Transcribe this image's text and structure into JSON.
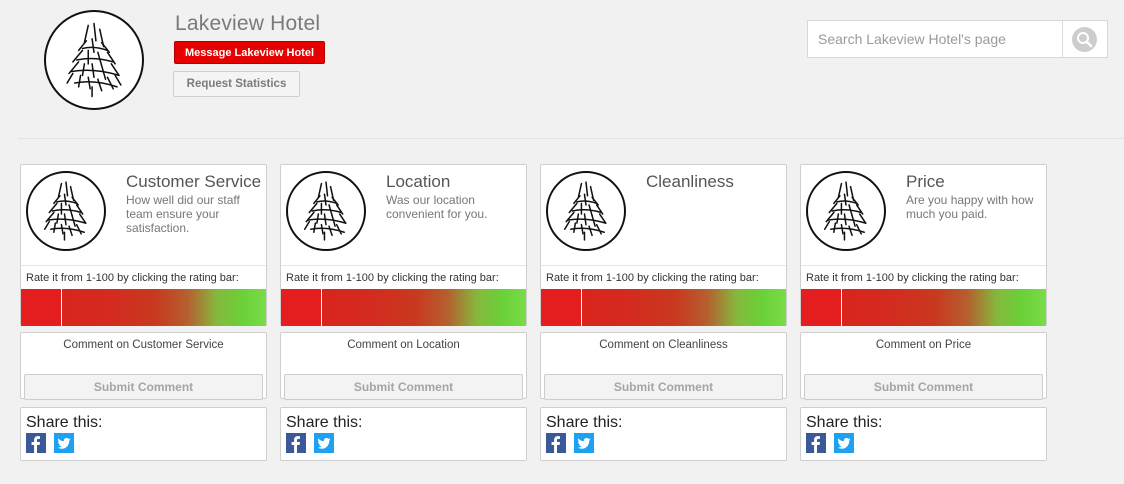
{
  "header": {
    "hotel_name": "Lakeview Hotel",
    "message_button": "Message Lakeview Hotel",
    "stats_button": "Request Statistics",
    "search_placeholder": "Search Lakeview Hotel's page"
  },
  "icons": {
    "logo": "pine-tree-logo-icon",
    "search": "search-icon",
    "facebook": "facebook-icon",
    "twitter": "twitter-icon"
  },
  "colors": {
    "message_button": "#e60000",
    "rating_low": "#e0201a",
    "rating_high": "#79dc49",
    "facebook": "#3b5998",
    "twitter": "#1da1f2"
  },
  "cards": [
    {
      "title": "Customer Service",
      "description": "How well did our staff team ensure your satisfaction.",
      "rate_label": "Rate it from 1-100 by clicking the rating bar:",
      "comment_label": "Comment on Customer Service",
      "submit_label": "Submit Comment",
      "share_label": "Share this:"
    },
    {
      "title": "Location",
      "description": "Was our location convenient for you.",
      "rate_label": "Rate it from 1-100 by clicking the rating bar:",
      "comment_label": "Comment on Location",
      "submit_label": "Submit Comment",
      "share_label": "Share this:"
    },
    {
      "title": "Cleanliness",
      "description": "",
      "rate_label": "Rate it from 1-100 by clicking the rating bar:",
      "comment_label": "Comment on Cleanliness",
      "submit_label": "Submit Comment",
      "share_label": "Share this:"
    },
    {
      "title": "Price",
      "description": "Are you happy with how much you paid.",
      "rate_label": "Rate it from 1-100 by clicking the rating bar:",
      "comment_label": "Comment on Price",
      "submit_label": "Submit Comment",
      "share_label": "Share this:"
    }
  ]
}
